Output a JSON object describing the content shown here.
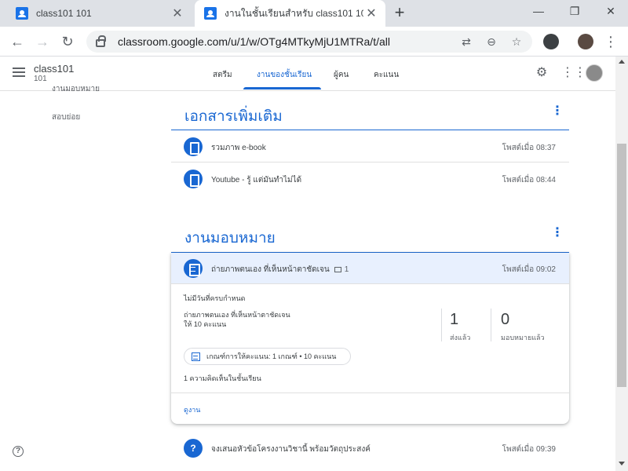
{
  "browser": {
    "tabs": [
      {
        "title": "class101 101"
      },
      {
        "title": "งานในชั้นเรียนสำหรับ class101 101"
      }
    ],
    "url": "classroom.google.com/u/1/w/OTg4MTkyMjU1MTRa/t/all"
  },
  "header": {
    "class_name": "class101",
    "class_section": "101",
    "tabs": [
      {
        "label": "สตรีม"
      },
      {
        "label": "งานของชั้นเรียน"
      },
      {
        "label": "ผู้คน"
      },
      {
        "label": "คะแนน"
      }
    ]
  },
  "sidebar": {
    "cut_item": "งานมอบหมาย",
    "item": "สอบย่อย"
  },
  "topics": [
    {
      "title": "เอกสารเพิ่มเติม",
      "items": [
        {
          "title": "รวมภาพ e-book",
          "posted": "โพสต์เมื่อ 08:37"
        },
        {
          "title": "Youtube - รู้ แต่มันทำไม่ได้",
          "posted": "โพสต์เมื่อ 08:44"
        }
      ]
    },
    {
      "title": "งานมอบหมาย",
      "expanded": {
        "title": "ถ่ายภาพตนเอง ที่เห็นหน้าตาชัดเจน",
        "comment_count": "1",
        "posted": "โพสต์เมื่อ 09:02",
        "due": "ไม่มีวันที่ครบกำหนด",
        "description": "ถ่ายภาพตนเอง ที่เห็นหน้าตาชัดเจน",
        "points": "ให้ 10 คะแนน",
        "turned_in_count": "1",
        "turned_in_label": "ส่งแล้ว",
        "assigned_count": "0",
        "assigned_label": "มอบหมายแล้ว",
        "rubric": "เกณฑ์การให้คะแนน: 1 เกณฑ์ • 10 คะแนน",
        "class_comments": "1 ความคิดเห็นในชั้นเรียน",
        "view_link": "ดูงาน"
      },
      "next_item": {
        "title": "จงเสนอหัวข้อโครงงานวิชานี้ พร้อมวัตถุประสงค์",
        "posted": "โพสต์เมื่อ 09:39"
      }
    }
  ],
  "colors": {
    "accent": "#1967d2",
    "highlight": "#e8f0fe"
  }
}
